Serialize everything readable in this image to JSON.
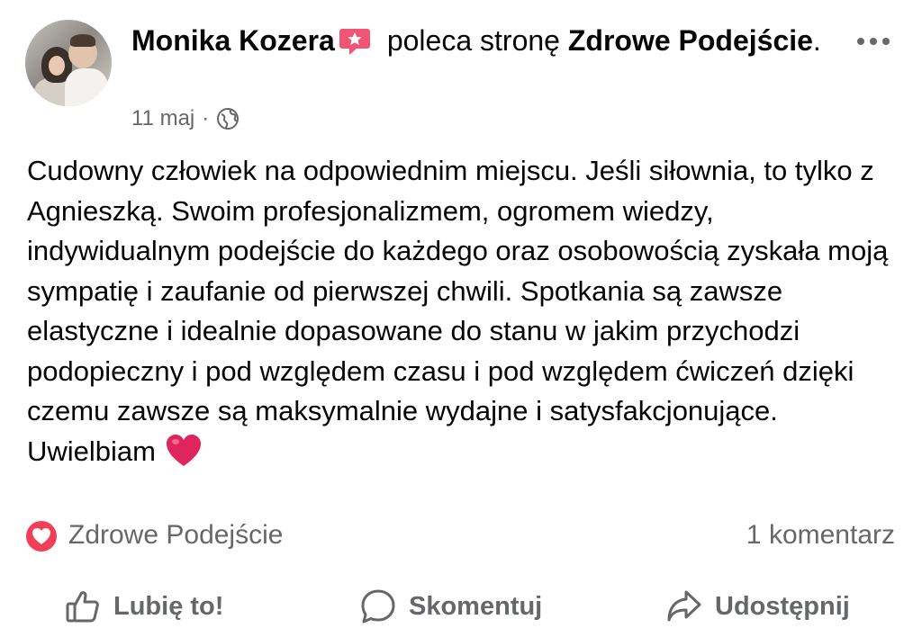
{
  "post": {
    "author": "Monika Kozera",
    "action_text": "poleca stronę",
    "page_name": "Zdrowe Podejście",
    "page_name_suffix": ".",
    "date": "11 maj",
    "separator": "·",
    "privacy_icon": "globe-icon",
    "badge_icon": "recommend-badge-icon",
    "more_icon": "more-options-icon",
    "body": "Cudowny człowiek na odpowiednim miejscu. Jeśli siłownia, to tylko z Agnieszką. Swoim profesjonalizmem, ogromem wiedzy, indywidualnym podejście do każdego oraz osobowością zyskała moją sympatię i zaufanie od pierwszej chwili. Spotkania są zawsze elastyczne i idealnie dopasowane do stanu w jakim przychodzi podopieczny i pod względem czasu i pod względem ćwiczeń dzięki czemu zawsze są maksymalnie wydajne i satysfakcjonujące.        Uwielbiam",
    "body_emoji": "red-heart-emoji"
  },
  "reactions": {
    "icon": "love-reaction-icon",
    "label": "Zdrowe Podejście",
    "comments": "1 komentarz"
  },
  "actions": {
    "like": "Lubię to!",
    "comment": "Skomentuj",
    "share": "Udostępnij"
  },
  "colors": {
    "text_primary": "#050505",
    "text_secondary": "#65676b",
    "badge": "#f05573",
    "heart": "#e0245e"
  }
}
